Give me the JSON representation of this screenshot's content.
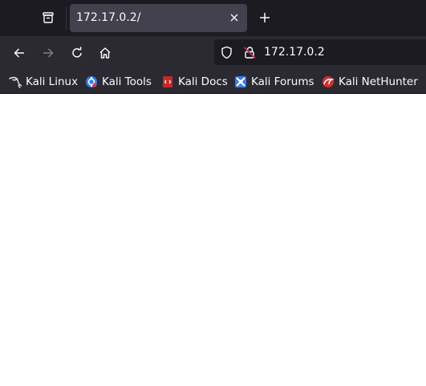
{
  "tab": {
    "title": "172.17.0.2/"
  },
  "toolbar": {
    "url": "172.17.0.2"
  },
  "bookmarks": [
    {
      "label": "Kali Linux",
      "icon": "kali-dragon-icon"
    },
    {
      "label": "Kali Tools",
      "icon": "kali-tools-icon"
    },
    {
      "label": "Kali Docs",
      "icon": "kali-docs-icon"
    },
    {
      "label": "Kali Forums",
      "icon": "kali-forums-icon"
    },
    {
      "label": "Kali NetHunter",
      "icon": "kali-nethunter-icon"
    }
  ],
  "colors": {
    "tabstrip_bg": "#1c1b22",
    "toolbar_bg": "#2b2a33",
    "active_tab_bg": "#42414d",
    "text": "#fbfbfe",
    "page_bg": "#ffffff"
  }
}
